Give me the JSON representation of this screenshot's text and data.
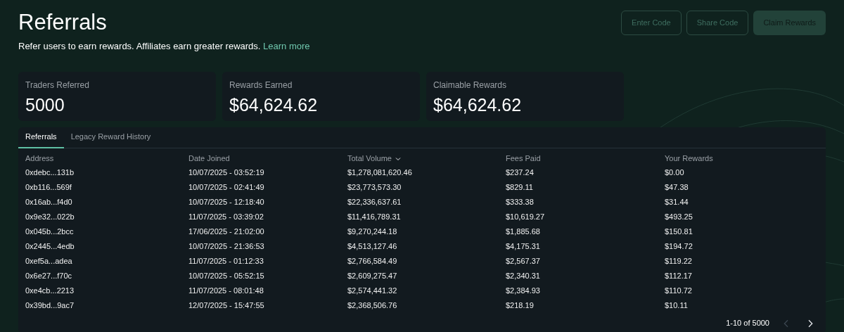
{
  "header": {
    "title": "Referrals",
    "subtitle": "Refer users to earn rewards. Affiliates earn greater rewards.",
    "link": "Learn more"
  },
  "buttons": [
    {
      "label": "Enter Code",
      "kind": "outline"
    },
    {
      "label": "Share Code",
      "kind": "outline"
    },
    {
      "label": "Claim Rewards",
      "kind": "filled"
    }
  ],
  "stats": [
    {
      "label": "Traders Referred",
      "value": "5000"
    },
    {
      "label": "Rewards Earned",
      "value": "$64,624.62"
    },
    {
      "label": "Claimable Rewards",
      "value": "$64,624.62"
    }
  ],
  "tabs": [
    {
      "label": "Referrals",
      "selected": true
    },
    {
      "label": "Legacy Reward History",
      "selected": false
    }
  ],
  "table": {
    "columns": [
      {
        "label": "Address",
        "sorted": false
      },
      {
        "label": "Date Joined",
        "sorted": false
      },
      {
        "label": "Total Volume",
        "sorted": true
      },
      {
        "label": "Fees Paid",
        "sorted": false
      },
      {
        "label": "Your Rewards",
        "sorted": false
      }
    ],
    "rows": [
      [
        "0xdebc...131b",
        "10/07/2025 - 03:52:19",
        "$1,278,081,620.46",
        "$237.24",
        "$0.00"
      ],
      [
        "0xb116...569f",
        "10/07/2025 - 02:41:49",
        "$23,773,573.30",
        "$829.11",
        "$47.38"
      ],
      [
        "0x16ab...f4d0",
        "10/07/2025 - 12:18:40",
        "$22,336,637.61",
        "$333.38",
        "$31.44"
      ],
      [
        "0x9e32...022b",
        "11/07/2025 - 03:39:02",
        "$11,416,789.31",
        "$10,619.27",
        "$493.25"
      ],
      [
        "0x045b...2bcc",
        "17/06/2025 - 21:02:00",
        "$9,270,244.18",
        "$1,885.68",
        "$150.81"
      ],
      [
        "0x2445...4edb",
        "10/07/2025 - 21:36:53",
        "$4,513,127.46",
        "$4,175.31",
        "$194.72"
      ],
      [
        "0xef5a...adea",
        "11/07/2025 - 01:12:33",
        "$2,766,584.49",
        "$2,567.37",
        "$119.22"
      ],
      [
        "0x6e27...f70c",
        "10/07/2025 - 05:52:15",
        "$2,609,275.47",
        "$2,340.31",
        "$112.17"
      ],
      [
        "0xe4cb...2213",
        "11/07/2025 - 08:01:48",
        "$2,574,441.32",
        "$2,384.93",
        "$110.72"
      ],
      [
        "0x39bd...9ac7",
        "12/07/2025 - 15:47:55",
        "$2,368,506.76",
        "$218.19",
        "$10.11"
      ]
    ]
  },
  "pagination": {
    "range": "1-10 of 5000",
    "prev_disabled": true,
    "next_disabled": false
  }
}
